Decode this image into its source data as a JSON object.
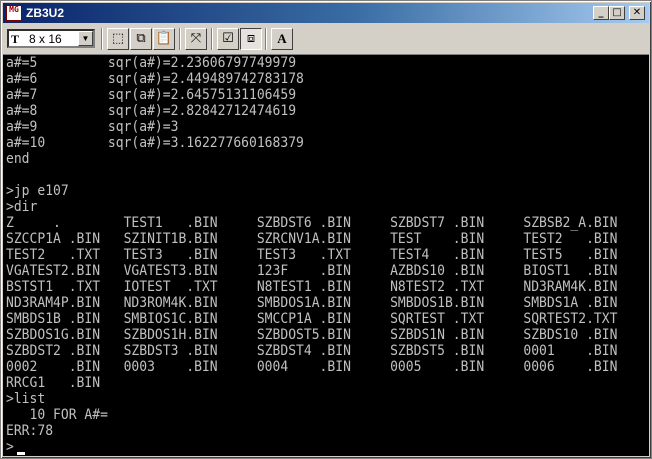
{
  "window": {
    "title": "ZB3U2",
    "icon_text": "MG",
    "controls": [
      "_",
      "□",
      "✕"
    ]
  },
  "toolbar": {
    "font_icon": "T",
    "font_value": "8 x 16",
    "buttons": [
      {
        "name": "mark-icon",
        "glyph": "⬚"
      },
      {
        "name": "copy-icon",
        "glyph": "⧉"
      },
      {
        "name": "paste-icon",
        "glyph": "📋"
      },
      {
        "name": "fullscreen-icon",
        "glyph": "⤧"
      },
      {
        "name": "properties-icon",
        "glyph": "☑"
      },
      {
        "name": "background-icon",
        "glyph": "⧈"
      },
      {
        "name": "font-icon",
        "glyph": "A"
      }
    ]
  },
  "console_lines": [
    "a#=5         sqr(a#)=2.23606797749979",
    "a#=6         sqr(a#)=2.449489742783178",
    "a#=7         sqr(a#)=2.64575131106459",
    "a#=8         sqr(a#)=2.82842712474619",
    "a#=9         sqr(a#)=3",
    "a#=10        sqr(a#)=3.162277660168379",
    "end",
    "",
    ">jp e107",
    ">dir",
    "Z     .        TEST1   .BIN     SZBDST6 .BIN     SZBDST7 .BIN     SZBSB2_A.BIN",
    "SZCCP1A .BIN   SZINIT1B.BIN     SZRCNV1A.BIN     TEST    .BIN     TEST2   .BIN",
    "TEST2   .TXT   TEST3   .BIN     TEST3   .TXT     TEST4   .BIN     TEST5   .BIN",
    "VGATEST2.BIN   VGATEST3.BIN     123F    .BIN     AZBDS10 .BIN     BIOST1  .BIN",
    "BSTST1  .TXT   IOTEST  .TXT     N8TEST1 .BIN     N8TEST2 .TXT     ND3RAM4K.BIN",
    "ND3RAM4P.BIN   ND3ROM4K.BIN     SMBDOS1A.BIN     SMBDOS1B.BIN     SMBDS1A .BIN",
    "SMBDS1B .BIN   SMBIOS1C.BIN     SMCCP1A .BIN     SQRTEST .TXT     SQRTEST2.TXT",
    "SZBDOS1G.BIN   SZBDOS1H.BIN     SZBDOST5.BIN     SZBDS1N .BIN     SZBDS10 .BIN",
    "SZBDST2 .BIN   SZBDST3 .BIN     SZBDST4 .BIN     SZBDST5 .BIN     0001    .BIN",
    "0002    .BIN   0003    .BIN     0004    .BIN     0005    .BIN     0006    .BIN",
    "RRCG1   .BIN",
    ">list",
    "   10 FOR A#=",
    "ERR:78",
    ">"
  ]
}
